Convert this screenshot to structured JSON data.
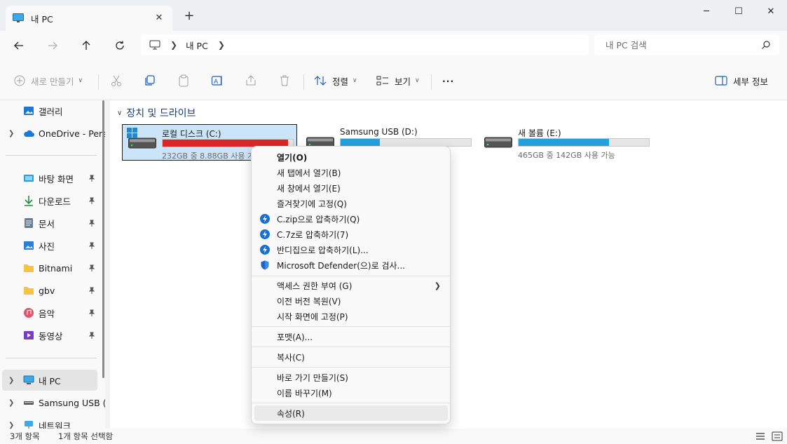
{
  "window": {
    "tab_title": "내 PC",
    "new_tab": "+",
    "min": "─",
    "max": "☐",
    "close": "✕"
  },
  "nav": {
    "breadcrumb": "내 PC",
    "search_placeholder": "내 PC 검색"
  },
  "toolbar": {
    "new_label": "새로 만들기",
    "sort_label": "정렬",
    "view_label": "보기",
    "more_label": "···",
    "details_label": "세부 정보"
  },
  "sidebar": {
    "gallery": "갤러리",
    "onedrive": "OneDrive - Pers",
    "desktop": "바탕 화면",
    "downloads": "다운로드",
    "documents": "문서",
    "pictures": "사진",
    "bitnami": "Bitnami",
    "gbv": "gbv",
    "music": "음악",
    "videos": "동영상",
    "this_pc": "내 PC",
    "usb": "Samsung USB (",
    "network": "네트워크"
  },
  "main": {
    "group_title": "장치 및 드라이브",
    "drives": [
      {
        "name": "로컬 디스크 (C:)",
        "space": "232GB 중 8.88GB 사용 가능",
        "used_fraction": 0.962,
        "color": "#da2626"
      },
      {
        "name": "Samsung USB (D:)",
        "space": "",
        "used_fraction": 0.3,
        "color": "#26a0da"
      },
      {
        "name": "새 볼륨 (E:)",
        "space": "465GB 중 142GB 사용 가능",
        "used_fraction": 0.695,
        "color": "#26a0da"
      }
    ]
  },
  "context_menu": {
    "open": "열기(O)",
    "open_new_tab": "새 탭에서 열기(B)",
    "open_new_window": "새 창에서 열기(E)",
    "pin_quick_access": "즐겨찾기에 고정(Q)",
    "compress_zip": "C.zip으로 압축하기(Q)",
    "compress_7z": "C.7z로 압축하기(7)",
    "compress_bandizip": "반디집으로 압축하기(L)...",
    "defender_scan": "Microsoft Defender(으)로 검사...",
    "give_access": "액세스 권한 부여 (G)",
    "restore_versions": "이전 버전 복원(V)",
    "pin_start": "시작 화면에 고정(P)",
    "format": "포맷(A)...",
    "copy": "복사(C)",
    "create_shortcut": "바로 가기 만들기(S)",
    "rename": "이름 바꾸기(M)",
    "properties": "속성(R)"
  },
  "status": {
    "item_count": "3개 항목",
    "selected": "1개 항목 선택함"
  }
}
